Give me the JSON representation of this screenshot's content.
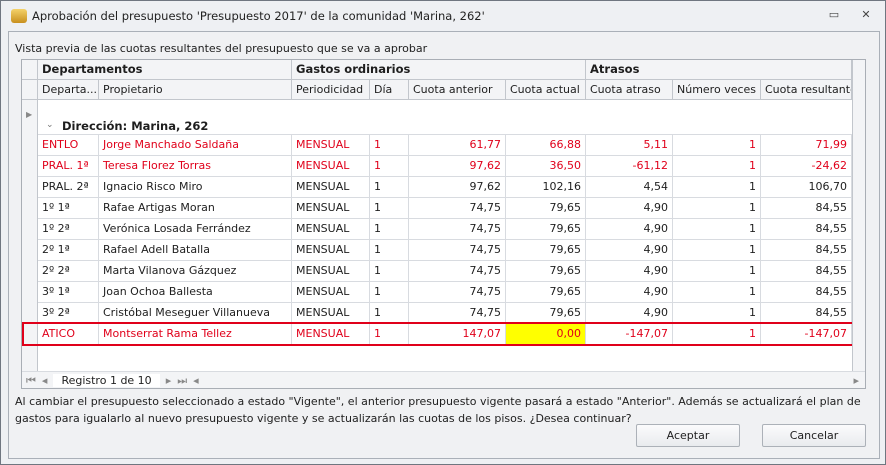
{
  "window": {
    "title": "Aprobación del presupuesto 'Presupuesto 2017' de la comunidad 'Marina, 262'"
  },
  "caption": "Vista previa de las cuotas resultantes del presupuesto que se va a aprobar",
  "bands": [
    "Departamentos",
    "Gastos ordinarios",
    "Atrasos"
  ],
  "columns": [
    "Departa...",
    "Propietario",
    "Periodicidad",
    "Día",
    "Cuota anterior",
    "Cuota actual",
    "Cuota atraso",
    "Número veces",
    "Cuota resultante"
  ],
  "group": "Dirección: Marina, 262",
  "rows": [
    {
      "dep": "ENTLO",
      "prop": "Jorge Manchado Saldaña",
      "per": "MENSUAL",
      "dia": "1",
      "ant": "61,77",
      "act": "66,88",
      "atr": "5,11",
      "veces": "1",
      "res": "71,99",
      "red": true
    },
    {
      "dep": "PRAL. 1ª",
      "prop": "Teresa Florez Torras",
      "per": "MENSUAL",
      "dia": "1",
      "ant": "97,62",
      "act": "36,50",
      "atr": "-61,12",
      "veces": "1",
      "res": "-24,62",
      "red": true
    },
    {
      "dep": "PRAL. 2ª",
      "prop": "Ignacio Risco Miro",
      "per": "MENSUAL",
      "dia": "1",
      "ant": "97,62",
      "act": "102,16",
      "atr": "4,54",
      "veces": "1",
      "res": "106,70"
    },
    {
      "dep": "1º 1ª",
      "prop": "Rafae Artigas Moran",
      "per": "MENSUAL",
      "dia": "1",
      "ant": "74,75",
      "act": "79,65",
      "atr": "4,90",
      "veces": "1",
      "res": "84,55"
    },
    {
      "dep": "1º 2ª",
      "prop": "Verónica Losada Ferrández",
      "per": "MENSUAL",
      "dia": "1",
      "ant": "74,75",
      "act": "79,65",
      "atr": "4,90",
      "veces": "1",
      "res": "84,55"
    },
    {
      "dep": "2º 1ª",
      "prop": "Rafael Adell Batalla",
      "per": "MENSUAL",
      "dia": "1",
      "ant": "74,75",
      "act": "79,65",
      "atr": "4,90",
      "veces": "1",
      "res": "84,55"
    },
    {
      "dep": "2º 2ª",
      "prop": "Marta Vilanova Gázquez",
      "per": "MENSUAL",
      "dia": "1",
      "ant": "74,75",
      "act": "79,65",
      "atr": "4,90",
      "veces": "1",
      "res": "84,55"
    },
    {
      "dep": "3º 1ª",
      "prop": "Joan Ochoa Ballesta",
      "per": "MENSUAL",
      "dia": "1",
      "ant": "74,75",
      "act": "79,65",
      "atr": "4,90",
      "veces": "1",
      "res": "84,55"
    },
    {
      "dep": "3º 2ª",
      "prop": "Cristóbal Meseguer Villanueva",
      "per": "MENSUAL",
      "dia": "1",
      "ant": "74,75",
      "act": "79,65",
      "atr": "4,90",
      "veces": "1",
      "res": "84,55"
    },
    {
      "dep": "ATICO",
      "prop": "Montserrat Rama Tellez",
      "per": "MENSUAL",
      "dia": "1",
      "ant": "147,07",
      "act": "0,00",
      "atr": "-147,07",
      "veces": "1",
      "res": "-147,07",
      "red": true,
      "highlight": true
    }
  ],
  "nav": {
    "record": "Registro 1 de 10"
  },
  "message": "Al cambiar el presupuesto seleccionado a estado \"Vigente\", el anterior presupuesto vigente pasará a estado \"Anterior\". Además se actualizará el plan de gastos para igualarlo al nuevo presupuesto vigente y se actualizarán las cuotas de los pisos. ¿Desea continuar?",
  "buttons": {
    "accept": "Aceptar",
    "cancel": "Cancelar"
  },
  "colors": {
    "red": "#e0001a",
    "highlight": "#ffff00"
  }
}
